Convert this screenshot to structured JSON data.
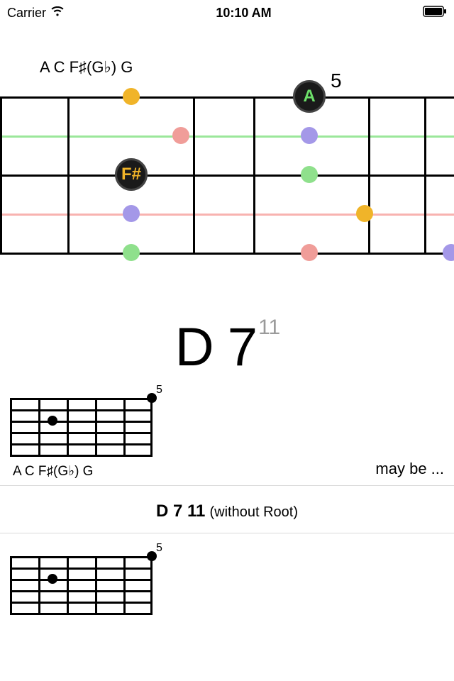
{
  "status": {
    "carrier": "Carrier",
    "time": "10:10 AM"
  },
  "notes_label": "A C F♯(G♭) G",
  "main_fret": {
    "num": "5",
    "markers": {
      "a": "A",
      "fsharp": "F#"
    }
  },
  "chord_main": {
    "root": "D 7",
    "ext": "11"
  },
  "row1": {
    "mini_num": "5",
    "mini_notes": "A C F♯(G♭) G",
    "maybe": "may be ..."
  },
  "sub_chord": {
    "bold": "D 7 11",
    "paren": "(without Root)"
  },
  "row2": {
    "mini_num": "5"
  }
}
